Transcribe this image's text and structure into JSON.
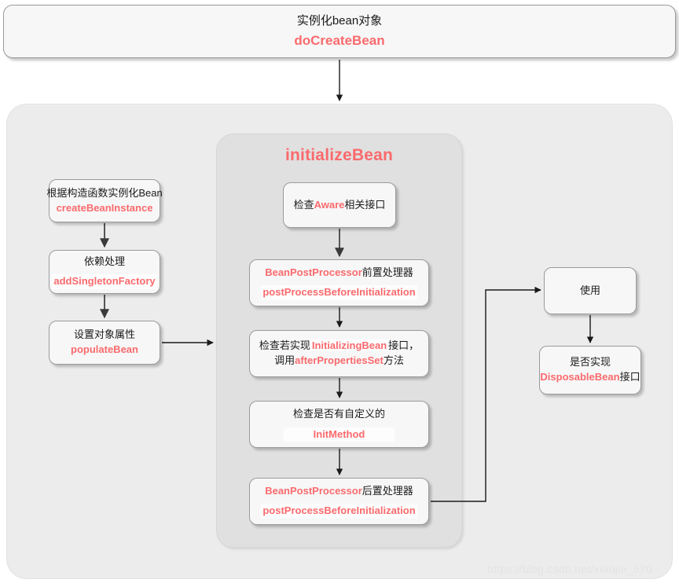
{
  "diagram": {
    "top_node": {
      "line1": "实例化bean对象",
      "line2": "doCreateBean"
    },
    "init_container": {
      "title": "initializeBean"
    },
    "left_column": [
      {
        "line1": "根据构造函数实例化Bean",
        "line2": "createBeanInstance"
      },
      {
        "line1": "依赖处理",
        "line2": "addSingletonFactory"
      },
      {
        "line1": "设置对象属性",
        "line2": "populateBean"
      }
    ],
    "center_column": [
      {
        "pre": "检查",
        "code": "Aware",
        "post": "相关接口"
      },
      {
        "l1_code": "BeanPostProcessor",
        "l1_post": "前置处理器",
        "l2_code": "postProcessBeforeInitialization"
      },
      {
        "l1_pre": "检查若实现",
        "l1_code": "InitializingBean",
        "l1_post": "接口，",
        "l2_pre": "调用",
        "l2_code": "afterPropertiesSet",
        "l2_post": "方法"
      },
      {
        "l1": "检查是否有自定义的",
        "l2_code": "InitMethod"
      },
      {
        "l1_code": "BeanPostProcessor",
        "l1_post": "后置处理器",
        "l2_code": "postProcessBeforeInitialization"
      }
    ],
    "right_column": [
      {
        "line1": "使用"
      },
      {
        "line1": "是否实现",
        "l2_code": "DisposableBean",
        "l2_post": "接口"
      }
    ],
    "watermark": "https://blog.csdn.net/xiaojie_570",
    "colors": {
      "accent_red": "#fa6a6d",
      "outer_bg": "#ececec",
      "inner_bg": "#e0e0e0",
      "node_bg": "#f7f7f7",
      "node_border": "#9a9a9a",
      "text": "#1a1a1a",
      "watermark": "#e3e3e3"
    }
  }
}
